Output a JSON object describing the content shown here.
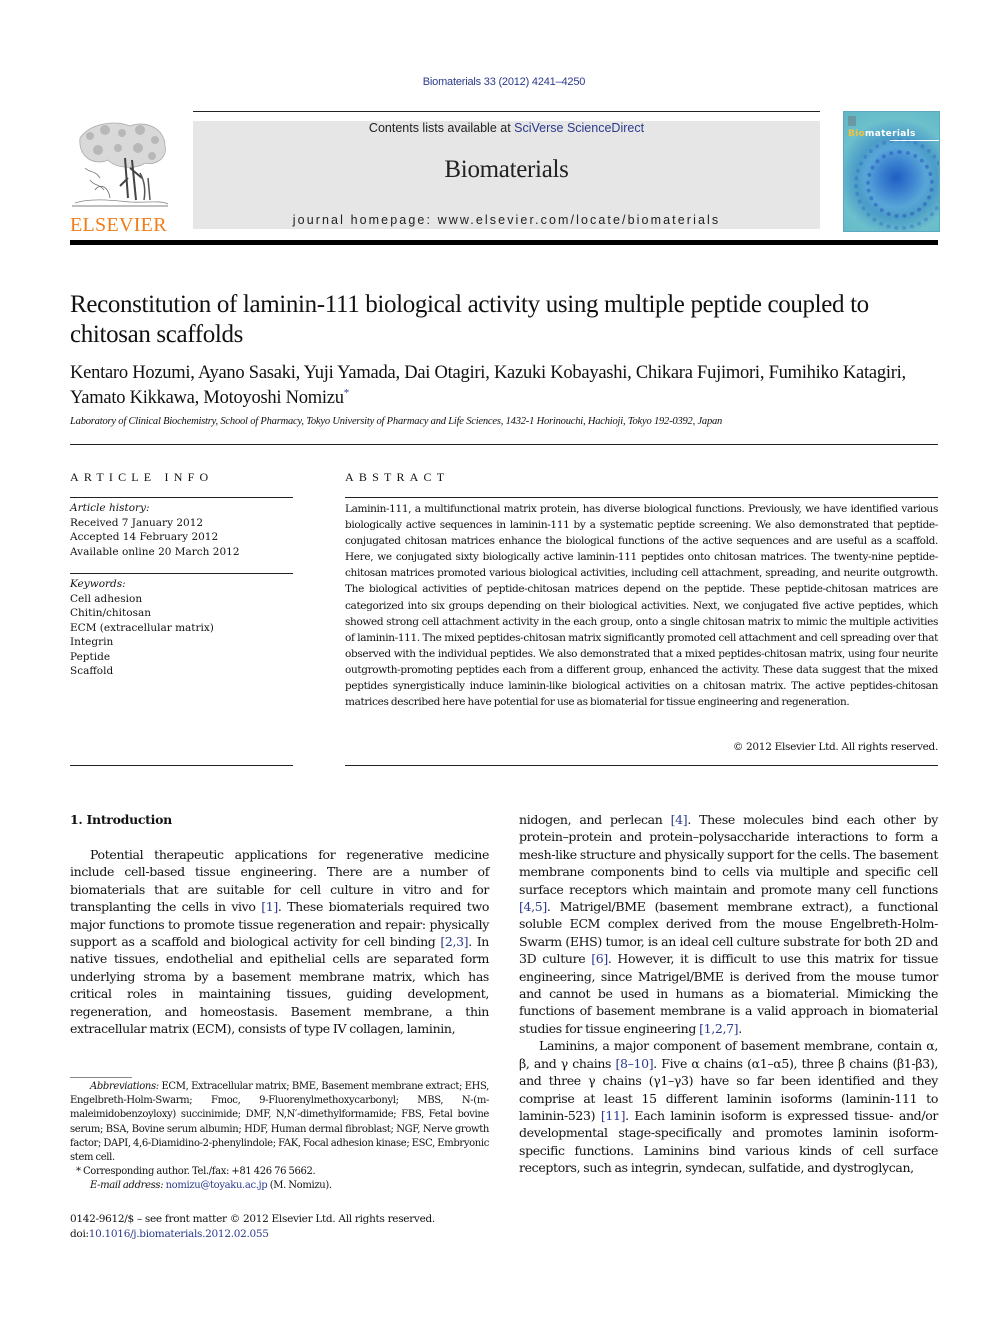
{
  "header": {
    "citation": "Biomaterials 33 (2012) 4241–4250",
    "publisher_logo_text": "ELSEVIER",
    "contents_prefix": "Contents lists available at ",
    "contents_link": "SciVerse ScienceDirect",
    "journal_name": "Biomaterials",
    "homepage_label": "journal homepage: ",
    "homepage_url": "www.elsevier.com/locate/biomaterials",
    "cover_title_highlight": "Bio",
    "cover_title_rest": "materials",
    "colors": {
      "link": "#2b3a8c",
      "elsevier_orange": "#ef7d1a",
      "masthead_bg": "#e6e6e6"
    }
  },
  "article": {
    "title": "Reconstitution of laminin-111 biological activity using multiple peptide coupled to chitosan scaffolds",
    "authors": "Kentaro Hozumi, Ayano Sasaki, Yuji Yamada, Dai Otagiri, Kazuki Kobayashi, Chikara Fujimori, Fumihiko Katagiri, Yamato Kikkawa, Motoyoshi Nomizu",
    "corresponding_marker": "*",
    "affiliation": "Laboratory of Clinical Biochemistry, School of Pharmacy, Tokyo University of Pharmacy and Life Sciences, 1432-1 Horinouchi, Hachioji, Tokyo 192-0392, Japan"
  },
  "article_info": {
    "heading": "ARTICLE INFO",
    "history_label": "Article history:",
    "history": [
      "Received 7 January 2012",
      "Accepted 14 February 2012",
      "Available online 20 March 2012"
    ],
    "keywords_label": "Keywords:",
    "keywords": [
      "Cell adhesion",
      "Chitin/chitosan",
      "ECM (extracellular matrix)",
      "Integrin",
      "Peptide",
      "Scaffold"
    ]
  },
  "abstract": {
    "heading": "ABSTRACT",
    "text": "Laminin-111, a multifunctional matrix protein, has diverse biological functions. Previously, we have identified various biologically active sequences in laminin-111 by a systematic peptide screening. We also demonstrated that peptide-conjugated chitosan matrices enhance the biological functions of the active sequences and are useful as a scaffold. Here, we conjugated sixty biologically active laminin-111 peptides onto chitosan matrices. The twenty-nine peptide-chitosan matrices promoted various biological activi­ties, including cell attachment, spreading, and neurite outgrowth. The biological activities of peptide-chitosan matrices depend on the peptide. These peptide-chitosan matrices are categorized into six groups depending on their biological activities. Next, we conjugated five active peptides, which showed strong cell attachment activity in the each group, onto a single chitosan matrix to mimic the multiple activities of laminin-111. The mixed peptides-chitosan matrix significantly promoted cell attachment and cell spreading over that observed with the individual peptides. We also demonstrated that a mixed peptides-chitosan matrix, using four neurite outgrowth-promoting peptides each from a different group, enhanced the activity. These data suggest that the mixed peptides synergistically induce laminin-like biological activities on a chitosan matrix. The active peptides-chitosan matrices described here have potential for use as biomaterial for tissue engineering and regeneration.",
    "copyright": "© 2012 Elsevier Ltd. All rights reserved."
  },
  "introduction": {
    "heading": "1.  Introduction",
    "left_p1": [
      "Potential therapeutic applications for regenerative medicine include cell-based tissue engineering. There are a number of biomaterials that are suitable for cell culture in vitro and for transplanting the cells in vivo ",
      "[1]",
      ". These biomaterials required two major functions to promote tissue regeneration and repair: physi­cally support as a scaffold and biological activity for cell binding ",
      "[2,3]",
      ". In native tissues, endothelial and epithelial cells are separated form underlying stroma by a basement membrane matrix, which has critical roles in maintaining tissues, guiding development, regeneration, and homeostasis. Basement membrane, a thin extracellular matrix (ECM), consists of type IV collagen, laminin,"
    ],
    "right_p1": [
      "nidogen, and perlecan ",
      "[4]",
      ". These molecules bind each other by protein–protein and protein–polysaccharide interactions to form a mesh-like structure and physically support for the cells. The basement membrane components bind to cells via multiple and specific cell surface receptors which maintain and promote many cell functions ",
      "[4,5]",
      ". Matrigel/BME (basement membrane extract), a functional soluble ECM complex derived from the mouse Engelbreth-Holm-Swarm (EHS) tumor, is an ideal cell culture substrate for both 2D and 3D culture ",
      "[6]",
      ". However, it is difficult to use this matrix for tissue engineering, since Matrigel/BME is derived from the mouse tumor and cannot be used in humans as a biomaterial. Mimicking the functions of basement membrane is a valid approach in biomaterial studies for tissue engineering ",
      "[1,2,7]",
      "."
    ],
    "right_p2": [
      "Laminins, a major component of basement membrane, contain α, β, and γ chains ",
      "[8–10]",
      ". Five α chains (α1–α5), three β chains (β1-β3), and three γ chains (γ1–γ3) have so far been identified and they comprise at least 15 different laminin isoforms (laminin-111 to laminin-523) ",
      "[11]",
      ". Each laminin isoform is expressed tissue- and/or developmental stage-specifically and promotes laminin isoform-specific functions. Laminins bind various kinds of cell surface receptors, such as integrin, syndecan, sulfatide, and dystroglycan,"
    ]
  },
  "footnotes": {
    "abbreviations_label": "Abbreviations:",
    "abbreviations_text": " ECM, Extracellular matrix; BME, Basement membrane extract; EHS, Engelbreth-Holm-Swarm; Fmoc, 9-Fluorenylmethoxycarbonyl; MBS, N-(m-maleimidobenzoyloxy) succinimide; DMF, N,N′-dimethylformamide; FBS, Fetal bovine serum; BSA, Bovine serum albumin; HDF, Human dermal fibroblast; NGF, Nerve growth factor; DAPI, 4,6-Diamidino-2-phenylindole; FAK, Focal adhesion kinase; ESC, Embryonic stem cell.",
    "corresponding": "* Corresponding author. Tel./fax: +81 426 76 5662.",
    "email_label": "E-mail address:",
    "email": "nomizu@toyaku.ac.jp",
    "email_suffix": " (M. Nomizu)."
  },
  "footer": {
    "issn_line": "0142-9612/$ – see front matter © 2012 Elsevier Ltd. All rights reserved.",
    "doi_label": "doi:",
    "doi": "10.1016/j.biomaterials.2012.02.055"
  }
}
